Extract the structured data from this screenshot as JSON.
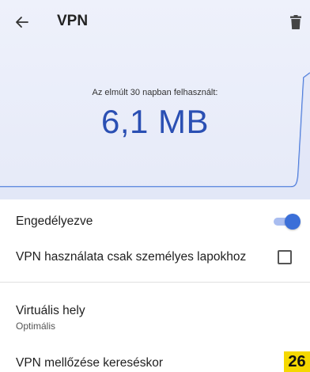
{
  "app_bar": {
    "back_icon": "arrow-left-icon",
    "title": "VPN",
    "delete_icon": "trash-icon"
  },
  "usage": {
    "caption": "Az elmúlt 30 napban felhasznált:",
    "value": "6,1 MB"
  },
  "settings": {
    "enabled_label": "Engedélyezve",
    "enabled_on": true,
    "personal_tabs_label": "VPN használata csak személyes lapokhoz",
    "personal_tabs_checked": false,
    "location_label": "Virtuális hely",
    "location_value": "Optimális",
    "bypass_label": "VPN mellőzése kereséskor"
  },
  "badge": "26",
  "colors": {
    "header_bg": "#e8ecf9",
    "accent": "#3b6fd8",
    "value_text": "#2a4fb3",
    "badge_bg": "#f5d800"
  }
}
